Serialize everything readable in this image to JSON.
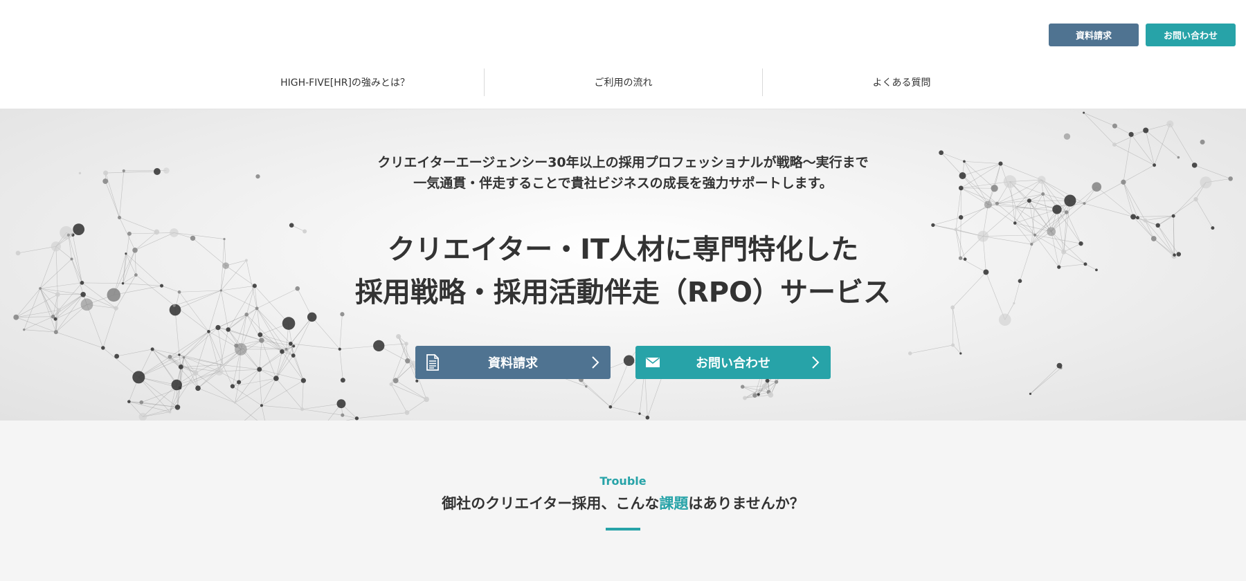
{
  "header": {
    "doc_button_label": "資料請求",
    "contact_button_label": "お問い合わせ",
    "nav": [
      {
        "label": "HIGH-FIVE[HR]の強みとは？"
      },
      {
        "label": "ご利用の流れ"
      },
      {
        "label": "よくある質問"
      }
    ]
  },
  "hero": {
    "subtitle_line1": "クリエイターエージェンシー30年以上の採用プロフェッショナルが戦略〜実行まで",
    "subtitle_line2": "一気通貫・伴走することで貴社ビジネスの成長を強力サポートします。",
    "title_line1": "クリエイター・IT人材に専門特化した",
    "title_line2": "採用戦略・採用活動伴走（RPO）サービス",
    "doc_button": {
      "label": "資料請求",
      "icon": "document-icon"
    },
    "contact_button": {
      "label": "お問い合わせ",
      "icon": "envelope-icon"
    }
  },
  "trouble": {
    "label": "Trouble",
    "heading_before": "御社のクリエイター採用、こんな",
    "heading_highlight": "課題",
    "heading_after": "はありませんか？"
  },
  "colors": {
    "accent_blue": "#4f7391",
    "accent_teal": "#27a3a8",
    "text": "#333333",
    "section_bg": "#f5f5f5"
  }
}
